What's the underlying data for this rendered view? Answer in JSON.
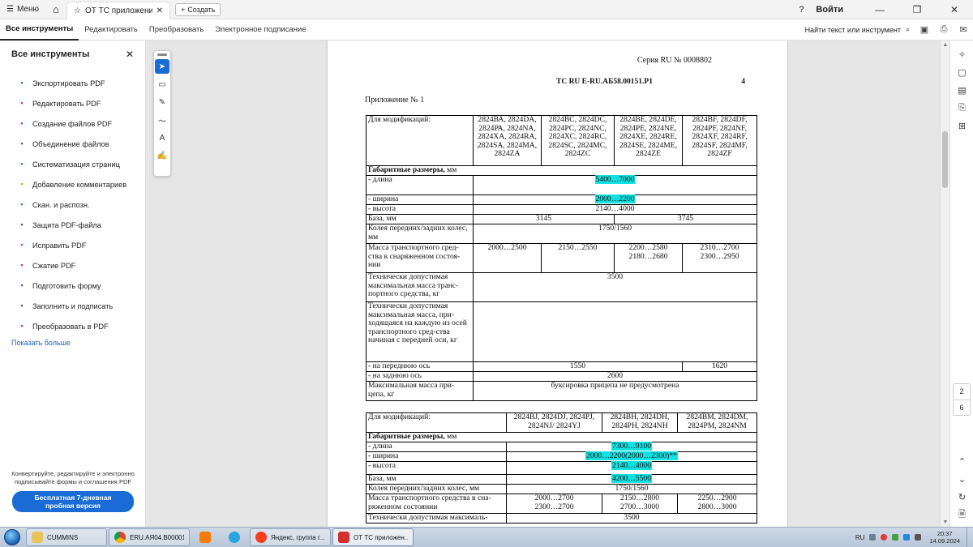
{
  "titlebar": {
    "menu_label": "Меню",
    "tab_title": "ОТ ТС приложение...",
    "create_label": "Создать",
    "login_label": "Войти"
  },
  "toolbar": {
    "tabs": [
      "Все инструменты",
      "Редактировать",
      "Преобразовать",
      "Электронное подписание"
    ],
    "find_label": "Найти текст или инструмент"
  },
  "sidebar": {
    "title": "Все инструменты",
    "items": [
      {
        "label": "Экспортировать PDF",
        "color": "#1e8a4c"
      },
      {
        "label": "Редактировать PDF",
        "color": "#d6336c"
      },
      {
        "label": "Создание файлов PDF",
        "color": "#d6336c"
      },
      {
        "label": "Объединение файлов",
        "color": "#6f42c1"
      },
      {
        "label": "Систематизация страниц",
        "color": "#1e8a4c"
      },
      {
        "label": "Добавление комментариев",
        "color": "#e0a800"
      },
      {
        "label": "Скан. и распозн.",
        "color": "#1e8a4c"
      },
      {
        "label": "Защита PDF-файла",
        "color": "#4a3fb6"
      },
      {
        "label": "Исправить PDF",
        "color": "#d6336c"
      },
      {
        "label": "Сжатие PDF",
        "color": "#d6336c"
      },
      {
        "label": "Подготовить форму",
        "color": "#6f42c1"
      },
      {
        "label": "Заполнить и подписать",
        "color": "#6f42c1"
      },
      {
        "label": "Преобразовать в PDF",
        "color": "#d6336c"
      }
    ],
    "show_more": "Показать больше",
    "promo_text": "Конвертируйте, редактируйте и электронно подписывайте формы и соглашения PDF",
    "trial_button": "Бесплатная 7-дневная пробная версия"
  },
  "document": {
    "serial": "Серия RU № 0008802",
    "cert_number": "ТС RU E-RU.АБ58.00151.Р1",
    "page_num": "4",
    "appendix": "Приложение № 1",
    "table1": {
      "mods_label": "Для модификаций:",
      "mods": [
        "2824ВА, 2824DA, 2824РА, 2824NA, 2824ХА, 2824RA, 2824SA, 2824MA, 2824ZA",
        "2824ВС, 2824DC, 2824РС, 2824NC, 2824ХС, 2824RC, 2824SC, 2824MC, 2824ZC",
        "2824ВЕ, 2824DE, 2824РЕ, 2824NE, 2824ХЕ, 2824RE, 2824SE, 2824ME, 2824ZE",
        "2824BF, 2824DF, 2824PF, 2824NF, 2824XF, 2824RF, 2824SF, 2824MF, 2824ZF"
      ],
      "dims_label": "Габаритные размеры,",
      "dims_unit": " мм",
      "length_label": "- длина",
      "length": "5400…7000",
      "width_label": "- ширина",
      "width": "2000…2200",
      "height_label": "- высота",
      "height": "2140…4000",
      "base_label": "База, мм",
      "base": [
        "3145",
        "3745"
      ],
      "track_label": "Колея передних/задних колес, мм",
      "track": "1750/1560",
      "mass_label": "Масса транспортного сред-ства в снаряженном состоя-нии",
      "mass": [
        "2000…2500",
        "2150…2550",
        "2200…2580",
        "2180…2680",
        "2310…2700",
        "2300…2950"
      ],
      "max_mass_label": "Технически допустимая максимальная масса транс-портного средства, кг",
      "max_mass": "3500",
      "axle_label": "Технически допустимая максимальная масса, при-ходящаяся на каждую из осей транспортного сред-ства начиная с передней оси, кг",
      "front_label": "- на переднюю ось",
      "front": [
        "1550",
        "1620"
      ],
      "rear_label": "- на заднюю ось",
      "rear": "2600",
      "trailer_label": "Максимальная масса при-цепа, кг",
      "trailer": "буксировка прицепа не предусмотрена"
    },
    "table2": {
      "mods_label": "Для модификаций:",
      "mods": [
        "2824BJ, 2824DJ, 2824PJ, 2824NJ/ 2824YJ",
        "2824BH, 2824DH, 2824PH, 2824NH",
        "2824BM, 2824DM, 2824PM, 2824NM"
      ],
      "dims_label": "Габаритные размеры,",
      "dims_unit": " мм",
      "length_label": "- длина",
      "length": "7300…9100",
      "width_label": "- ширина",
      "width": "2000…2200(2000…2300)**",
      "height_label": "- высота",
      "height": "2140…4000",
      "base_label": "База, мм",
      "base": "4200…5500",
      "track_label": "Колея передних/задних  колес, мм",
      "track": "1750/1560",
      "mass_label": "Масса транспортного средства в сна-ряженном состоянии",
      "mass": [
        "2000…2700",
        "2300…2700",
        "2150…2800",
        "2700…3000",
        "2250…2900",
        "2800…3000"
      ],
      "max_mass_label": "Технически допустимая максималь-",
      "max_mass": "3500"
    }
  },
  "right_rail": {
    "page_current": "2",
    "page_total": "6"
  },
  "taskbar": {
    "items": [
      "CUMMINS",
      "ERU.AЯ04.B00001...",
      "Яндекс, группа г...",
      "ОТ ТС приложен..."
    ],
    "lang": "RU",
    "time": "20:37",
    "date": "14.09.2024"
  }
}
